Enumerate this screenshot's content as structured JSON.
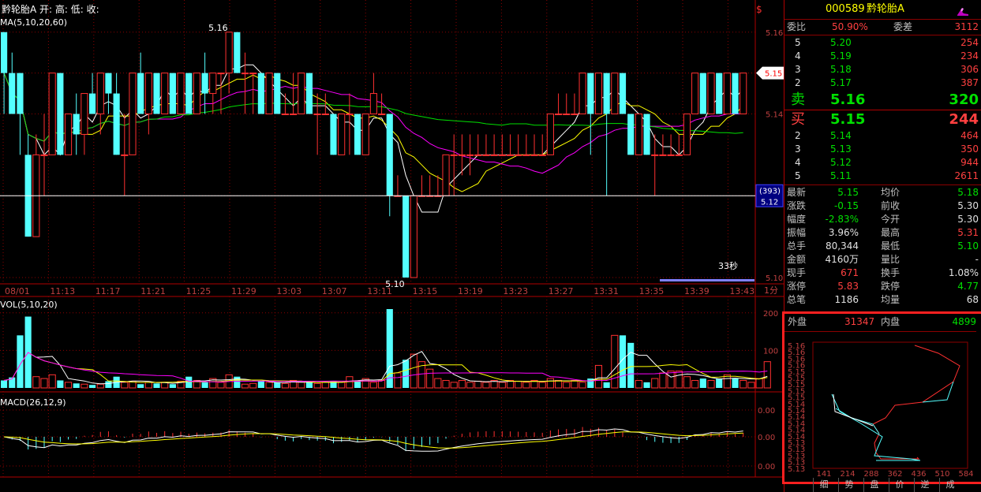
{
  "header": {
    "stock_name": "黔轮胎A",
    "ohlc_prefix": "开: 高: 低: 收:",
    "ma_label": "MA(5,10,20,60)",
    "vol_label": "VOL(5,10,20)",
    "macd_label": "MACD(26,12,9)",
    "countdown": "33秒",
    "period": "1分"
  },
  "quote": {
    "code": "000589",
    "name": "黔轮胎A",
    "weibi_label": "委比",
    "weibi_value": "50.90%",
    "weicha_label": "委差",
    "weicha_value": "3112",
    "sell_label": "卖",
    "buy_label": "买",
    "sell_levels": [
      {
        "level": "5",
        "price": "5.20",
        "volume": "254"
      },
      {
        "level": "4",
        "price": "5.19",
        "volume": "234"
      },
      {
        "level": "3",
        "price": "5.18",
        "volume": "306"
      },
      {
        "level": "2",
        "price": "5.17",
        "volume": "387"
      }
    ],
    "sell1_price": "5.16",
    "sell1_volume": "320",
    "buy1_price": "5.15",
    "buy1_volume": "244",
    "buy_levels": [
      {
        "level": "2",
        "price": "5.14",
        "volume": "464"
      },
      {
        "level": "3",
        "price": "5.13",
        "volume": "350"
      },
      {
        "level": "4",
        "price": "5.12",
        "volume": "944"
      },
      {
        "level": "5",
        "price": "5.11",
        "volume": "2611"
      }
    ],
    "stats": [
      {
        "l1": "最新",
        "v1": "5.15",
        "l2": "均价",
        "v2": "5.18",
        "c1": "green",
        "c2": "green"
      },
      {
        "l1": "涨跌",
        "v1": "-0.15",
        "l2": "前收",
        "v2": "5.30",
        "c1": "green",
        "c2": "white"
      },
      {
        "l1": "幅度",
        "v1": "-2.83%",
        "l2": "今开",
        "v2": "5.30",
        "c1": "green",
        "c2": "white"
      },
      {
        "l1": "振幅",
        "v1": "3.96%",
        "l2": "最高",
        "v2": "5.31",
        "c1": "white",
        "c2": "red"
      },
      {
        "l1": "总手",
        "v1": "80,344",
        "l2": "最低",
        "v2": "5.10",
        "c1": "white",
        "c2": "green"
      },
      {
        "l1": "金额",
        "v1": "4160万",
        "l2": "量比",
        "v2": "-",
        "c1": "white",
        "c2": "white"
      },
      {
        "l1": "现手",
        "v1": "671",
        "l2": "换手",
        "v2": "1.08%",
        "c1": "red",
        "c2": "white"
      },
      {
        "l1": "涨停",
        "v1": "5.83",
        "l2": "跌停",
        "v2": "4.77",
        "c1": "red",
        "c2": "green"
      },
      {
        "l1": "总笔",
        "v1": "1186",
        "l2": "均量",
        "v2": "68",
        "c1": "white",
        "c2": "white"
      }
    ],
    "waipan_label": "外盘",
    "waipan_value": "31347",
    "neipan_label": "内盘",
    "neipan_value": "4899",
    "tabs": [
      "细",
      "势",
      "盘",
      "价",
      "逆",
      "成"
    ]
  },
  "chart_data": [
    {
      "type": "candlestick",
      "x_tick_labels": [
        "08/01",
        "11:13",
        "11:17",
        "11:21",
        "11:25",
        "11:29",
        "13:03",
        "13:07",
        "13:11",
        "13:15",
        "13:19",
        "13:23",
        "13:27",
        "13:31",
        "13:35",
        "13:39",
        "13:43"
      ],
      "y_tick_labels": [
        "5.16",
        "5.15",
        "5.14",
        "5.12",
        "5.10"
      ],
      "ylim": [
        5.1,
        5.164
      ],
      "ma_periods": [
        5,
        10,
        20,
        60
      ],
      "annotations": [
        {
          "text": "5.16",
          "price": 5.16
        },
        {
          "text": "5.10",
          "price": 5.1
        }
      ],
      "price_tag": {
        "label": "5.15",
        "price": 5.15
      },
      "crosshair": {
        "count": "(393)",
        "price": "5.12",
        "y": 5.12
      },
      "candles": [
        {
          "o": 5.16,
          "c": 5.15,
          "h": 5.16,
          "l": 5.14
        },
        {
          "o": 5.15,
          "c": 5.14,
          "h": 5.155,
          "l": 5.14
        },
        {
          "o": 5.15,
          "c": 5.14,
          "h": 5.15,
          "l": 5.13
        },
        {
          "o": 5.13,
          "c": 5.11,
          "h": 5.135,
          "l": 5.11
        },
        {
          "o": 5.11,
          "c": 5.13,
          "h": 5.135,
          "l": 5.11
        },
        {
          "o": 5.13,
          "c": 5.13,
          "h": 5.14,
          "l": 5.12
        },
        {
          "o": 5.13,
          "c": 5.15,
          "h": 5.15,
          "l": 5.13
        },
        {
          "o": 5.15,
          "c": 5.13,
          "h": 5.15,
          "l": 5.13
        },
        {
          "o": 5.13,
          "c": 5.14,
          "h": 5.14,
          "l": 5.13
        },
        {
          "o": 5.14,
          "c": 5.135,
          "h": 5.145,
          "l": 5.13
        },
        {
          "o": 5.135,
          "c": 5.145,
          "h": 5.145,
          "l": 5.13
        },
        {
          "o": 5.145,
          "c": 5.14,
          "h": 5.15,
          "l": 5.14
        },
        {
          "o": 5.14,
          "c": 5.15,
          "h": 5.15,
          "l": 5.135
        },
        {
          "o": 5.15,
          "c": 5.145,
          "h": 5.15,
          "l": 5.14
        },
        {
          "o": 5.145,
          "c": 5.13,
          "h": 5.15,
          "l": 5.13
        },
        {
          "o": 5.13,
          "c": 5.13,
          "h": 5.14,
          "l": 5.12
        },
        {
          "o": 5.13,
          "c": 5.15,
          "h": 5.15,
          "l": 5.13
        },
        {
          "o": 5.15,
          "c": 5.14,
          "h": 5.155,
          "l": 5.14
        },
        {
          "o": 5.14,
          "c": 5.15,
          "h": 5.15,
          "l": 5.135
        },
        {
          "o": 5.15,
          "c": 5.14,
          "h": 5.15,
          "l": 5.14
        },
        {
          "o": 5.14,
          "c": 5.15,
          "h": 5.15,
          "l": 5.14
        },
        {
          "o": 5.15,
          "c": 5.14,
          "h": 5.15,
          "l": 5.14
        },
        {
          "o": 5.14,
          "c": 5.15,
          "h": 5.15,
          "l": 5.14
        },
        {
          "o": 5.15,
          "c": 5.14,
          "h": 5.15,
          "l": 5.14
        },
        {
          "o": 5.14,
          "c": 5.15,
          "h": 5.15,
          "l": 5.14
        },
        {
          "o": 5.15,
          "c": 5.145,
          "h": 5.155,
          "l": 5.14
        },
        {
          "o": 5.145,
          "c": 5.15,
          "h": 5.15,
          "l": 5.14
        },
        {
          "o": 5.15,
          "c": 5.15,
          "h": 5.15,
          "l": 5.14
        },
        {
          "o": 5.15,
          "c": 5.16,
          "h": 5.16,
          "l": 5.145
        },
        {
          "o": 5.16,
          "c": 5.15,
          "h": 5.16,
          "l": 5.15
        },
        {
          "o": 5.15,
          "c": 5.15,
          "h": 5.155,
          "l": 5.14
        },
        {
          "o": 5.15,
          "c": 5.15,
          "h": 5.15,
          "l": 5.14
        },
        {
          "o": 5.15,
          "c": 5.14,
          "h": 5.15,
          "l": 5.14
        },
        {
          "o": 5.14,
          "c": 5.15,
          "h": 5.15,
          "l": 5.14
        },
        {
          "o": 5.15,
          "c": 5.14,
          "h": 5.15,
          "l": 5.14
        },
        {
          "o": 5.14,
          "c": 5.14,
          "h": 5.145,
          "l": 5.14
        },
        {
          "o": 5.14,
          "c": 5.14,
          "h": 5.15,
          "l": 5.14
        },
        {
          "o": 5.14,
          "c": 5.15,
          "h": 5.15,
          "l": 5.14
        },
        {
          "o": 5.15,
          "c": 5.14,
          "h": 5.15,
          "l": 5.14
        },
        {
          "o": 5.14,
          "c": 5.14,
          "h": 5.145,
          "l": 5.13
        },
        {
          "o": 5.14,
          "c": 5.14,
          "h": 5.145,
          "l": 5.14
        },
        {
          "o": 5.14,
          "c": 5.13,
          "h": 5.14,
          "l": 5.13
        },
        {
          "o": 5.13,
          "c": 5.14,
          "h": 5.14,
          "l": 5.13
        },
        {
          "o": 5.14,
          "c": 5.14,
          "h": 5.145,
          "l": 5.13
        },
        {
          "o": 5.14,
          "c": 5.13,
          "h": 5.14,
          "l": 5.13
        },
        {
          "o": 5.13,
          "c": 5.14,
          "h": 5.14,
          "l": 5.13
        },
        {
          "o": 5.14,
          "c": 5.145,
          "h": 5.15,
          "l": 5.14
        },
        {
          "o": 5.14,
          "c": 5.14,
          "h": 5.145,
          "l": 5.14
        },
        {
          "o": 5.14,
          "c": 5.12,
          "h": 5.14,
          "l": 5.115
        },
        {
          "o": 5.12,
          "c": 5.12,
          "h": 5.125,
          "l": 5.12
        },
        {
          "o": 5.12,
          "c": 5.1,
          "h": 5.12,
          "l": 5.1
        },
        {
          "o": 5.1,
          "c": 5.12,
          "h": 5.12,
          "l": 5.1
        },
        {
          "o": 5.12,
          "c": 5.12,
          "h": 5.125,
          "l": 5.12
        },
        {
          "o": 5.12,
          "c": 5.12,
          "h": 5.125,
          "l": 5.12
        },
        {
          "o": 5.12,
          "c": 5.12,
          "h": 5.125,
          "l": 5.12
        },
        {
          "o": 5.12,
          "c": 5.13,
          "h": 5.13,
          "l": 5.12
        },
        {
          "o": 5.13,
          "c": 5.13,
          "h": 5.135,
          "l": 5.12
        },
        {
          "o": 5.13,
          "c": 5.13,
          "h": 5.135,
          "l": 5.125
        },
        {
          "o": 5.13,
          "c": 5.13,
          "h": 5.135,
          "l": 5.125
        },
        {
          "o": 5.13,
          "c": 5.13,
          "h": 5.135,
          "l": 5.13
        },
        {
          "o": 5.13,
          "c": 5.13,
          "h": 5.135,
          "l": 5.13
        },
        {
          "o": 5.13,
          "c": 5.13,
          "h": 5.135,
          "l": 5.13
        },
        {
          "o": 5.13,
          "c": 5.13,
          "h": 5.135,
          "l": 5.13
        },
        {
          "o": 5.13,
          "c": 5.13,
          "h": 5.135,
          "l": 5.13
        },
        {
          "o": 5.13,
          "c": 5.13,
          "h": 5.135,
          "l": 5.13
        },
        {
          "o": 5.13,
          "c": 5.13,
          "h": 5.135,
          "l": 5.13
        },
        {
          "o": 5.13,
          "c": 5.13,
          "h": 5.135,
          "l": 5.13
        },
        {
          "o": 5.13,
          "c": 5.13,
          "h": 5.135,
          "l": 5.13
        },
        {
          "o": 5.13,
          "c": 5.14,
          "h": 5.14,
          "l": 5.13
        },
        {
          "o": 5.14,
          "c": 5.14,
          "h": 5.145,
          "l": 5.14
        },
        {
          "o": 5.14,
          "c": 5.14,
          "h": 5.145,
          "l": 5.14
        },
        {
          "o": 5.14,
          "c": 5.14,
          "h": 5.145,
          "l": 5.14
        },
        {
          "o": 5.14,
          "c": 5.15,
          "h": 5.15,
          "l": 5.14
        },
        {
          "o": 5.15,
          "c": 5.14,
          "h": 5.15,
          "l": 5.13
        },
        {
          "o": 5.14,
          "c": 5.15,
          "h": 5.15,
          "l": 5.14
        },
        {
          "o": 5.15,
          "c": 5.14,
          "h": 5.15,
          "l": 5.12
        },
        {
          "o": 5.14,
          "c": 5.15,
          "h": 5.15,
          "l": 5.14
        },
        {
          "o": 5.15,
          "c": 5.14,
          "h": 5.15,
          "l": 5.14
        },
        {
          "o": 5.14,
          "c": 5.13,
          "h": 5.14,
          "l": 5.13
        },
        {
          "o": 5.13,
          "c": 5.14,
          "h": 5.14,
          "l": 5.13
        },
        {
          "o": 5.14,
          "c": 5.13,
          "h": 5.14,
          "l": 5.13
        },
        {
          "o": 5.13,
          "c": 5.13,
          "h": 5.135,
          "l": 5.12
        },
        {
          "o": 5.13,
          "c": 5.13,
          "h": 5.135,
          "l": 5.13
        },
        {
          "o": 5.13,
          "c": 5.13,
          "h": 5.135,
          "l": 5.13
        },
        {
          "o": 5.13,
          "c": 5.13,
          "h": 5.135,
          "l": 5.13
        },
        {
          "o": 5.13,
          "c": 5.14,
          "h": 5.14,
          "l": 5.13
        },
        {
          "o": 5.14,
          "c": 5.15,
          "h": 5.15,
          "l": 5.14
        },
        {
          "o": 5.15,
          "c": 5.14,
          "h": 5.15,
          "l": 5.14
        },
        {
          "o": 5.14,
          "c": 5.15,
          "h": 5.15,
          "l": 5.14
        },
        {
          "o": 5.15,
          "c": 5.14,
          "h": 5.15,
          "l": 5.14
        },
        {
          "o": 5.14,
          "c": 5.15,
          "h": 5.15,
          "l": 5.14
        },
        {
          "o": 5.15,
          "c": 5.14,
          "h": 5.15,
          "l": 5.14
        },
        {
          "o": 5.14,
          "c": 5.15,
          "h": 5.15,
          "l": 5.14
        }
      ]
    },
    {
      "type": "bar",
      "title": "VOL(5,10,20)",
      "y_tick_labels": [
        "200",
        "100"
      ],
      "ylim": [
        0,
        210
      ],
      "volumes": [
        20,
        28,
        140,
        190,
        30,
        25,
        35,
        20,
        15,
        12,
        10,
        8,
        10,
        18,
        30,
        15,
        18,
        10,
        15,
        12,
        15,
        10,
        18,
        30,
        20,
        15,
        25,
        15,
        35,
        30,
        10,
        12,
        18,
        15,
        15,
        12,
        20,
        15,
        15,
        12,
        15,
        18,
        15,
        30,
        20,
        25,
        15,
        20,
        210,
        40,
        75,
        90,
        70,
        50,
        25,
        20,
        15,
        20,
        15,
        18,
        15,
        20,
        15,
        20,
        18,
        15,
        20,
        15,
        25,
        20,
        15,
        20,
        15,
        25,
        60,
        15,
        140,
        140,
        120,
        20,
        15,
        25,
        40,
        45,
        45,
        30,
        20,
        25,
        20,
        25,
        35,
        25,
        20,
        15,
        25,
        70
      ]
    },
    {
      "type": "bar",
      "title": "MACD(26,12,9)",
      "y_tick_labels": [
        "0.00",
        "0.00",
        "0.00"
      ]
    }
  ]
}
